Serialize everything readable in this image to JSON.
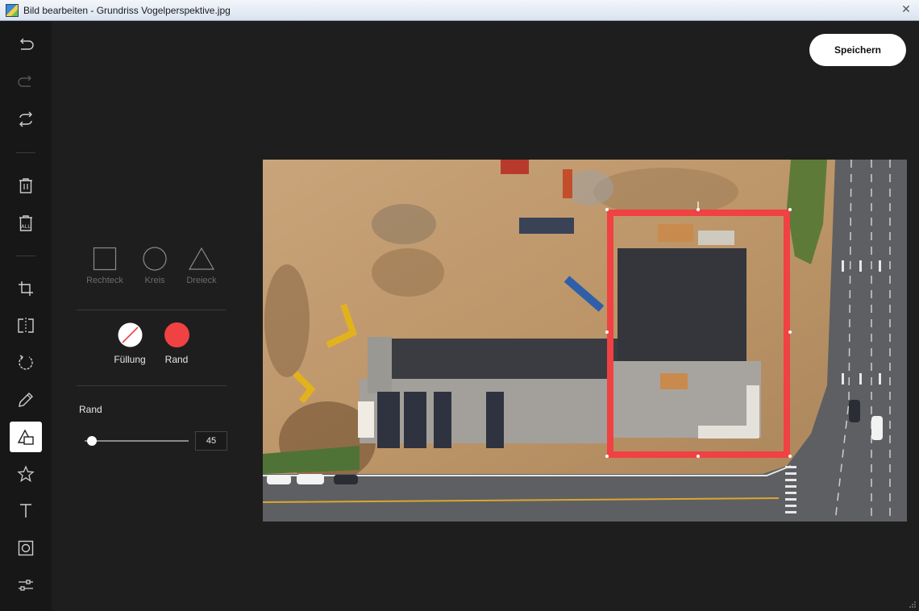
{
  "window": {
    "title": "Bild bearbeiten - Grundriss Vogelperspektive.jpg",
    "close_symbol": "✕"
  },
  "toolbar": {
    "tools": [
      {
        "name": "undo-icon"
      },
      {
        "name": "redo-icon"
      },
      {
        "name": "reset-icon"
      },
      {
        "name": "delete-icon"
      },
      {
        "name": "delete-all-icon",
        "text": "ALL"
      },
      {
        "name": "crop-icon"
      },
      {
        "name": "flip-icon"
      },
      {
        "name": "rotate-icon"
      },
      {
        "name": "draw-icon"
      },
      {
        "name": "shape-icon",
        "active": true
      },
      {
        "name": "star-icon"
      },
      {
        "name": "text-icon"
      },
      {
        "name": "mask-icon"
      },
      {
        "name": "filter-icon"
      }
    ]
  },
  "shape_panel": {
    "shapes": [
      {
        "label": "Rechteck"
      },
      {
        "label": "Kreis"
      },
      {
        "label": "Dreieck"
      }
    ],
    "fill": {
      "label": "Füllung",
      "color": "none"
    },
    "stroke": {
      "label": "Rand",
      "color": "#f04143"
    },
    "stroke_width": {
      "label": "Rand",
      "value": "45",
      "fraction": 0.07
    }
  },
  "header": {
    "save_label": "Speichern"
  },
  "canvas": {
    "selection_color": "#f04143"
  }
}
